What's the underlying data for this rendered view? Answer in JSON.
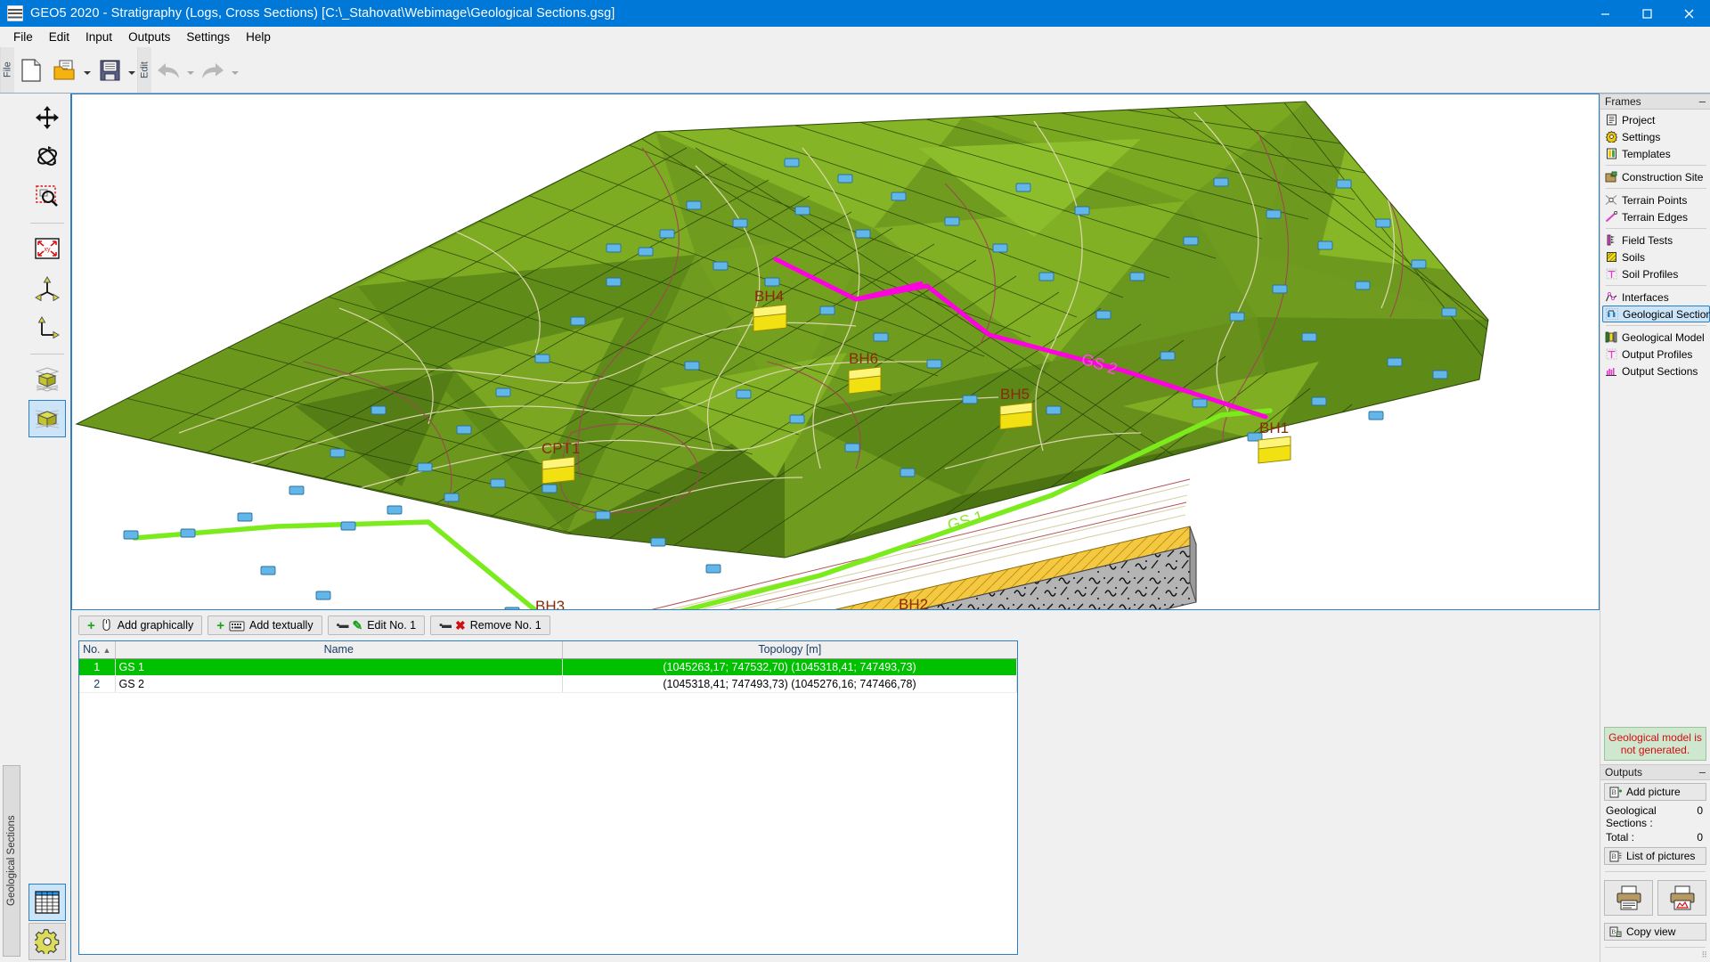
{
  "window": {
    "title": "GEO5 2020 - Stratigraphy (Logs, Cross Sections) [C:\\_Stahovat\\Webimage\\Geological Sections.gsg]",
    "app_icon": "geo5-logo-icon",
    "minimize": "–",
    "maximize": "☐",
    "close": "✕"
  },
  "menu": {
    "items": [
      "File",
      "Edit",
      "Input",
      "Outputs",
      "Settings",
      "Help"
    ]
  },
  "toolbar": {
    "file_group_label": "File",
    "edit_group_label": "Edit",
    "buttons": [
      {
        "name": "new-file-icon",
        "tip": "New"
      },
      {
        "name": "open-file-icon",
        "tip": "Open"
      },
      {
        "name": "save-file-icon",
        "tip": "Save"
      },
      {
        "name": "undo-icon",
        "tip": "Undo"
      },
      {
        "name": "redo-icon",
        "tip": "Redo"
      }
    ]
  },
  "view_tools": {
    "items": [
      {
        "name": "pan-tool",
        "label": "Translate",
        "selected": false
      },
      {
        "name": "rotate-tool",
        "label": "Rotate",
        "selected": false
      },
      {
        "name": "zoom-window-tool",
        "label": "Zoom window",
        "selected": false
      },
      {
        "name": "zoom-all-tool",
        "label": "Zoom all",
        "selected": false
      },
      {
        "name": "axonometry-tool",
        "label": "Axonometry",
        "selected": false
      },
      {
        "name": "plan-view-tool",
        "label": "Plan view",
        "selected": false
      },
      {
        "name": "wireframe-box-tool",
        "label": "Wireframe",
        "selected": false
      },
      {
        "name": "solid-box-tool",
        "label": "Solid view",
        "selected": true
      }
    ],
    "bottom": [
      {
        "name": "table-view-tool",
        "label": "Table view",
        "selected": true
      },
      {
        "name": "view-settings-tool",
        "label": "Drawing settings",
        "selected": false
      }
    ]
  },
  "left_tab": {
    "label": "Geological Sections"
  },
  "viewport": {
    "borehole_labels": [
      "BH4",
      "BH6",
      "BH5",
      "BH1",
      "BH2",
      "BH3",
      "CPT1"
    ],
    "section_labels": [
      "GS 1",
      "GS 2"
    ],
    "colors": {
      "gs1_line": "#7CEB1E",
      "gs2_line": "#FF00E0",
      "terrain_point": "#63b6e8",
      "borehole_marker": "#f2e112",
      "terrain_light": "#8fbe2a",
      "terrain_mid": "#6f9c1e",
      "terrain_dark": "#4e7a16",
      "soil_gravel": "#b0b0b0",
      "soil_sand": "#f5c842",
      "label_text": "#8a2a08"
    }
  },
  "table_toolbar": {
    "buttons": [
      {
        "name": "add-graphically-button",
        "label": "Add graphically",
        "icon": "plus-mouse-icon"
      },
      {
        "name": "add-textually-button",
        "label": "Add textually",
        "icon": "plus-keyboard-icon"
      },
      {
        "name": "edit-button",
        "label": "Edit No. 1",
        "icon": "pencil-icon"
      },
      {
        "name": "remove-button",
        "label": "Remove No. 1",
        "icon": "cross-icon"
      }
    ]
  },
  "table": {
    "columns": [
      "No.",
      "Name",
      "Topology [m]"
    ],
    "sort_column": "No.",
    "sort_direction": "asc",
    "rows": [
      {
        "no": "1",
        "name": "GS 1",
        "topology": "(1045263,17; 747532,70) (1045318,41; 747493,73)",
        "selected": true
      },
      {
        "no": "2",
        "name": "GS 2",
        "topology": "(1045318,41; 747493,73) (1045276,16; 747466,78)",
        "selected": false
      }
    ]
  },
  "frames": {
    "title": "Frames",
    "minimize": "–",
    "items": [
      {
        "label": "Project",
        "icon": "document-icon",
        "selected": false
      },
      {
        "label": "Settings",
        "icon": "gear-icon",
        "selected": false
      },
      {
        "label": "Templates",
        "icon": "templates-icon",
        "selected": false
      },
      {
        "separator_after": true,
        "label": "Construction Site",
        "icon": "construction-site-icon",
        "selected": false
      },
      {
        "separator_after": true,
        "label": "Terrain Points",
        "icon": "terrain-points-icon",
        "selected": false
      },
      {
        "label": "Terrain Edges",
        "icon": "terrain-edges-icon",
        "selected": false
      },
      {
        "separator_after": true,
        "label": "Field Tests",
        "icon": "field-tests-icon",
        "selected": false
      },
      {
        "label": "Soils",
        "icon": "soils-icon",
        "selected": false
      },
      {
        "label": "Soil Profiles",
        "icon": "soil-profiles-icon",
        "selected": false
      },
      {
        "separator_after": true,
        "label": "Interfaces",
        "icon": "interfaces-icon",
        "selected": false
      },
      {
        "label": "Geological Sections",
        "icon": "geological-sections-icon",
        "selected": true
      },
      {
        "separator_after": true,
        "label": "Geological Model",
        "icon": "geological-model-icon",
        "selected": false
      },
      {
        "label": "Output Profiles",
        "icon": "output-profiles-icon",
        "selected": false
      },
      {
        "label": "Output Sections",
        "icon": "output-sections-icon",
        "selected": false
      }
    ]
  },
  "status_note": {
    "line1": "Geological model is",
    "line2": "not generated."
  },
  "outputs": {
    "title": "Outputs",
    "minimize": "–",
    "add_picture": "Add picture",
    "rows": [
      {
        "label": "Geological Sections :",
        "value": "0"
      },
      {
        "label": "Total :",
        "value": "0"
      }
    ],
    "list_of_pictures": "List of pictures",
    "print_button": "print-document-icon",
    "print_picture_button": "print-picture-icon",
    "copy_view": "Copy view"
  }
}
